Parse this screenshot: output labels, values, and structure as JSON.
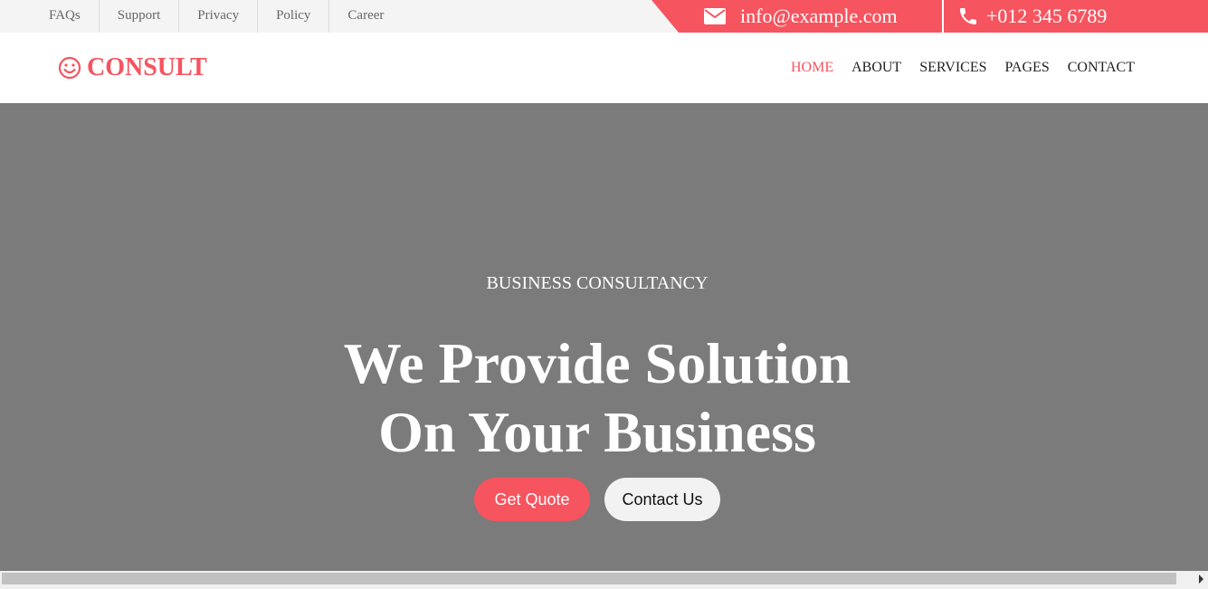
{
  "topbar": {
    "links": [
      "FAQs",
      "Support",
      "Privacy",
      "Policy",
      "Career"
    ],
    "email": "info@example.com",
    "phone": "+012 345 6789",
    "icons": {
      "email": "envelope-icon",
      "phone": "phone-icon"
    }
  },
  "navbar": {
    "brand": "CONSULT",
    "brand_icon": "smiley-icon",
    "items": [
      {
        "label": "HOME",
        "active": true
      },
      {
        "label": "ABOUT",
        "active": false
      },
      {
        "label": "SERVICES",
        "active": false
      },
      {
        "label": "PAGES",
        "active": false
      },
      {
        "label": "CONTACT",
        "active": false
      }
    ]
  },
  "hero": {
    "subtitle": "BUSINESS CONSULTANCY",
    "title_line1": "We Provide Solution",
    "title_line2": "On Your Business",
    "primary_button": "Get Quote",
    "secondary_button": "Contact Us"
  },
  "colors": {
    "accent": "#f6545f",
    "hero_bg": "#7b7b7b",
    "topbar_bg": "#f4f4f4"
  }
}
